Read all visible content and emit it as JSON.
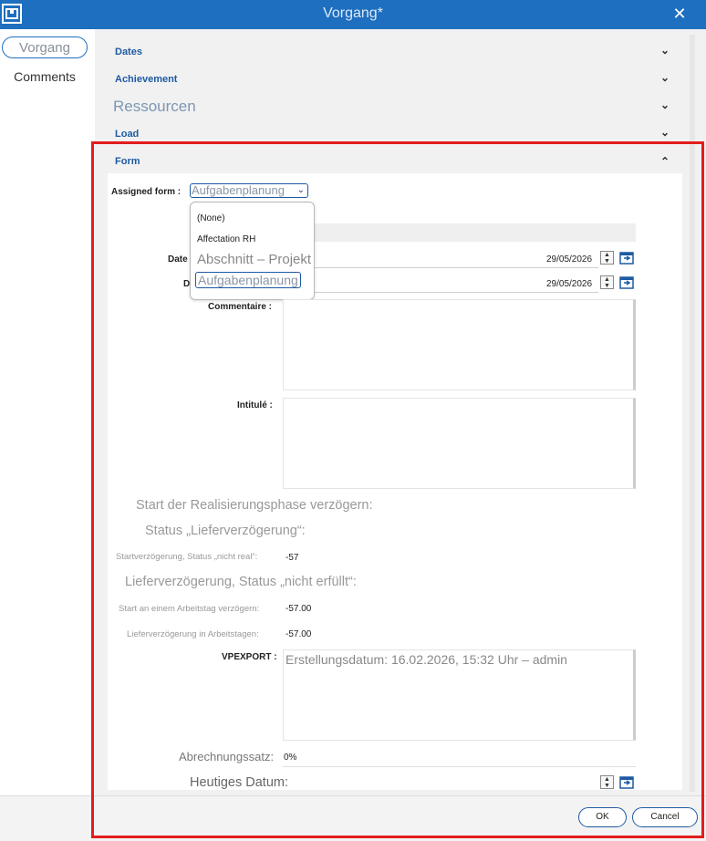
{
  "window": {
    "title": "Vorgang*",
    "close_icon": "close-icon"
  },
  "nav": {
    "items": [
      "Vorgang",
      "Comments"
    ],
    "selected": "Vorgang"
  },
  "sections": {
    "dates": "Dates",
    "achievement": "Achievement",
    "ressourcen": "Ressourcen",
    "load": "Load",
    "form": "Form"
  },
  "form": {
    "assigned_form_label": "Assigned form :",
    "assigned_form_value": "Aufgabenplanung",
    "dropdown_options": [
      "(None)",
      "Affectation RH",
      "Abschnitt – Projekt",
      "Aufgabenplanung"
    ],
    "date_label_1": "Date",
    "date_label_2": "D",
    "date_value_1": "29/05/2026",
    "date_value_2": "29/05/2026",
    "commentaire_label": "Commentaire :",
    "intitule_label": "Intitulé :",
    "start_delay_label": "Start der Realisierungsphase verzögern:",
    "status_delivery_label": "Status „Lieferverzögerung“:",
    "start_delay_status_label": "Startverzögerung, Status „nicht real“:",
    "start_delay_status_value": "-57",
    "delivery_delay_label": "Lieferverzögerung, Status „nicht erfüllt“:",
    "start_workday_label": "Start an einem Arbeitstag verzögern:",
    "start_workday_value": "-57.00",
    "delivery_workdays_label": "Lieferverzögerung in Arbeitstagen:",
    "delivery_workdays_value": "-57.00",
    "vpexport_label": "VPEXPORT :",
    "vpexport_value": "Erstellungsdatum: 16.02.2026, 15:32 Uhr – admin",
    "billing_rate_label": "Abrechnungssatz:",
    "billing_rate_value": "0%",
    "today_label": "Heutiges Datum:"
  },
  "footer": {
    "ok": "OK",
    "cancel": "Cancel"
  },
  "colors": {
    "titlebar": "#1e6fbf",
    "accent": "#1e5aa3",
    "highlight": "#e21d1d"
  }
}
